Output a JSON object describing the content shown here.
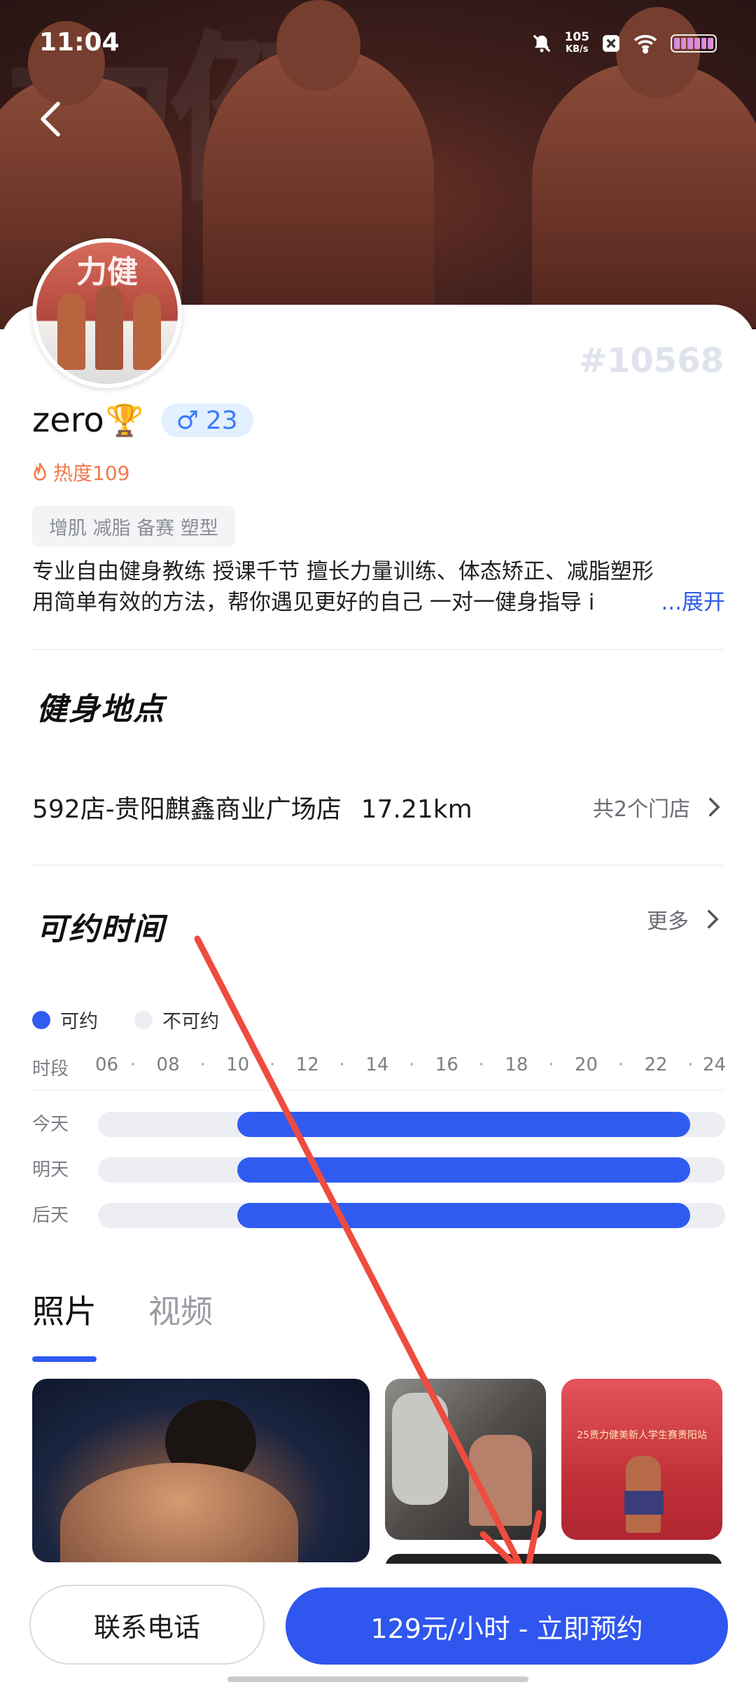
{
  "status_bar": {
    "time": "11:04",
    "net_speed_value": "105",
    "net_speed_unit": "KB/s"
  },
  "coach": {
    "id_label": "#10568",
    "name": "zero",
    "trophy_icon": "🏆",
    "gender_symbol": "♂",
    "age": "23",
    "heat_label": "热度109",
    "tags": "增肌 减脂 备赛 塑型",
    "bio_line1": "专业自由健身教练 授课千节 擅长力量训练、体态矫正、减脂塑形",
    "bio_line2": "用简单有效的方法，帮你遇见更好的自己 一对一健身指导 i",
    "bio_expand": "...展开"
  },
  "location": {
    "section_title": "健身地点",
    "store_name": "592店-贵阳麒鑫商业广场店",
    "distance": "17.21km",
    "store_count": "共2个门店"
  },
  "schedule": {
    "section_title": "可约时间",
    "more_label": "更多",
    "legend_available": "可约",
    "legend_unavailable": "不可约",
    "axis_label": "时段",
    "ticks": [
      "06",
      "08",
      "10",
      "12",
      "14",
      "16",
      "18",
      "20",
      "22",
      "24"
    ],
    "rows": [
      {
        "label": "今天",
        "available_from": 10,
        "available_to": 23
      },
      {
        "label": "明天",
        "available_from": 10,
        "available_to": 23
      },
      {
        "label": "后天",
        "available_from": 10,
        "available_to": 23
      }
    ],
    "axis_start": 6,
    "axis_end": 24
  },
  "media_tabs": {
    "photos": "照片",
    "videos": "视频"
  },
  "photos": {
    "caption3": "25贵力健美新人学生赛贵阳站"
  },
  "actions": {
    "contact_label": "联系电话",
    "book_label": "129元/小时 - 立即预约"
  },
  "colors": {
    "primary": "#2f56ee",
    "heat": "#f07a4a",
    "annotation_arrow": "#ef4b3f"
  },
  "hero_brush_text": "力健"
}
